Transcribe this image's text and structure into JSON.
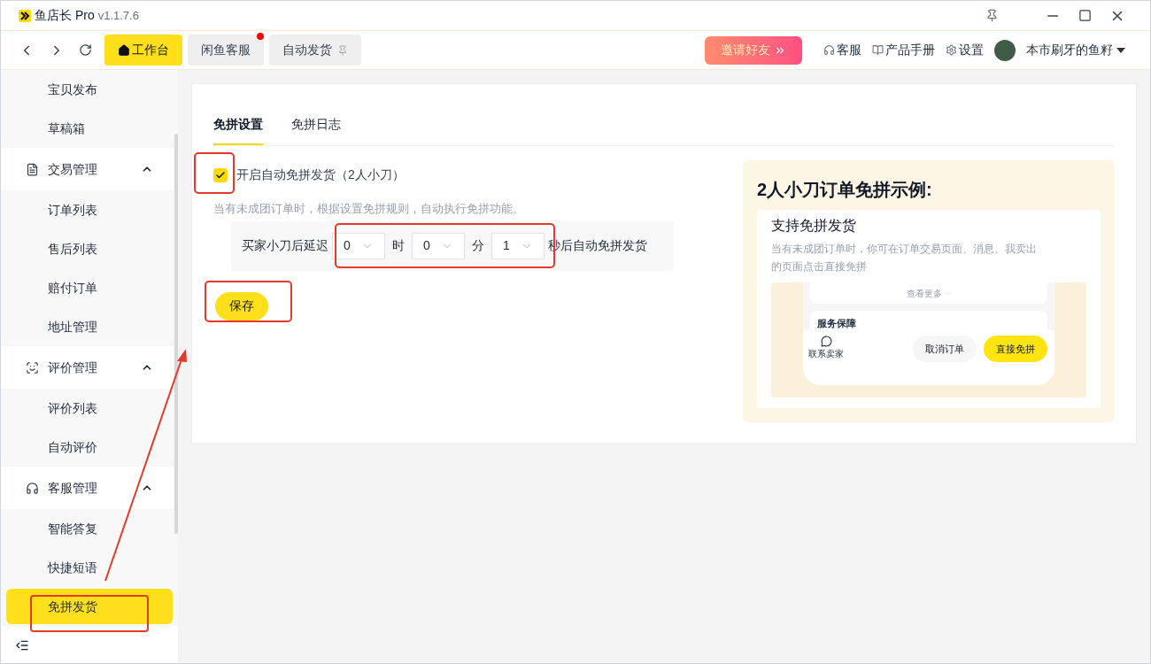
{
  "window": {
    "app_name": "鱼店长 Pro",
    "version": "v1.1.7.6"
  },
  "nav_tabs": [
    {
      "label": "工作台",
      "selected": true,
      "notification": false,
      "pinned": false
    },
    {
      "label": "闲鱼客服",
      "selected": false,
      "notification": true,
      "pinned": false
    },
    {
      "label": "自动发货",
      "selected": false,
      "notification": false,
      "pinned": true
    }
  ],
  "invite_button": "邀请好友",
  "header_links": [
    "客服",
    "产品手册",
    "设置"
  ],
  "user_name": "本市刷牙的鱼籽",
  "sidebar": [
    {
      "kind": "item",
      "label": "宝贝发布",
      "selected": false
    },
    {
      "kind": "item",
      "label": "草稿箱",
      "selected": false
    },
    {
      "kind": "group",
      "label": "交易管理",
      "expanded": true
    },
    {
      "kind": "item",
      "label": "订单列表",
      "selected": false
    },
    {
      "kind": "item",
      "label": "售后列表",
      "selected": false
    },
    {
      "kind": "item",
      "label": "赔付订单",
      "selected": false
    },
    {
      "kind": "item",
      "label": "地址管理",
      "selected": false
    },
    {
      "kind": "group",
      "label": "评价管理",
      "expanded": true
    },
    {
      "kind": "item",
      "label": "评价列表",
      "selected": false
    },
    {
      "kind": "item",
      "label": "自动评价",
      "selected": false
    },
    {
      "kind": "group",
      "label": "客服管理",
      "expanded": true
    },
    {
      "kind": "item",
      "label": "智能答复",
      "selected": false
    },
    {
      "kind": "item",
      "label": "快捷短语",
      "selected": false
    },
    {
      "kind": "item",
      "label": "免拼发货",
      "selected": true
    }
  ],
  "content_tabs": [
    {
      "label": "免拼设置",
      "selected": true
    },
    {
      "label": "免拼日志",
      "selected": false
    }
  ],
  "auto_option": {
    "label": "开启自动免拼发货（2人小刀）",
    "checked": true
  },
  "description": "当有未成团订单时，根据设置免拼规则，自动执行免拼功能。",
  "delay": {
    "prefix": "买家小刀后延迟",
    "fields": [
      {
        "value": "0",
        "unit": "时"
      },
      {
        "value": "0",
        "unit": "分"
      },
      {
        "value": "1"
      }
    ],
    "suffix": "秒后自动免拼发货"
  },
  "save_button": "保存",
  "example": {
    "title": "2人小刀订单免拼示例:",
    "card_title": "支持免拼发货",
    "card_text": "当有未成团订单时，你可在订单交易页面、消息、我卖出的页面点击直接免拼",
    "more": "查看更多",
    "service": "服务保障",
    "contact": "联系卖家",
    "cancel_button": "取消订单",
    "direct_button": "直接免拼"
  }
}
